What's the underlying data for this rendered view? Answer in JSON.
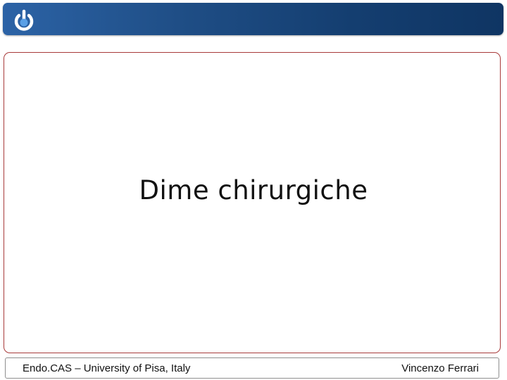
{
  "header": {
    "logo_icon": "power-circle-logo-icon",
    "accent_color": "#1f4e86"
  },
  "slide": {
    "title": "Dime chirurgiche"
  },
  "footer": {
    "left_text": "Endo.CAS – University of Pisa, Italy",
    "right_text": "Vincenzo Ferrari"
  }
}
